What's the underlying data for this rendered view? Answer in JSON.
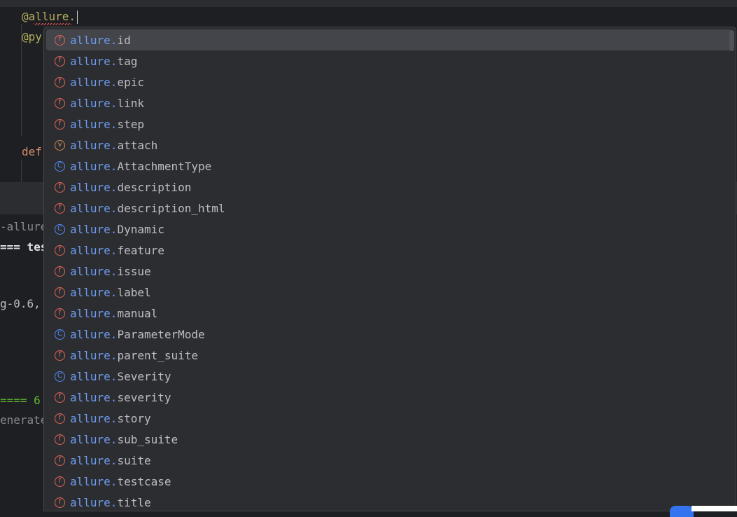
{
  "editor": {
    "line1": "@allure.",
    "line2": "@py",
    "line3": "def"
  },
  "console": {
    "l1": "-allure",
    "l2": "=== tes",
    "l3": "g-0.6,",
    "l4": "==== 6",
    "l5": "enerate"
  },
  "completion": {
    "prefix": "allure.",
    "items": [
      {
        "kind": "f",
        "name": "id"
      },
      {
        "kind": "f",
        "name": "tag"
      },
      {
        "kind": "f",
        "name": "epic"
      },
      {
        "kind": "f",
        "name": "link"
      },
      {
        "kind": "f",
        "name": "step"
      },
      {
        "kind": "v",
        "name": "attach"
      },
      {
        "kind": "c",
        "name": "AttachmentType"
      },
      {
        "kind": "f",
        "name": "description"
      },
      {
        "kind": "f",
        "name": "description_html"
      },
      {
        "kind": "c",
        "name": "Dynamic"
      },
      {
        "kind": "f",
        "name": "feature"
      },
      {
        "kind": "f",
        "name": "issue"
      },
      {
        "kind": "f",
        "name": "label"
      },
      {
        "kind": "f",
        "name": "manual"
      },
      {
        "kind": "c",
        "name": "ParameterMode"
      },
      {
        "kind": "f",
        "name": "parent_suite"
      },
      {
        "kind": "c",
        "name": "Severity"
      },
      {
        "kind": "f",
        "name": "severity"
      },
      {
        "kind": "f",
        "name": "story"
      },
      {
        "kind": "f",
        "name": "sub_suite"
      },
      {
        "kind": "f",
        "name": "suite"
      },
      {
        "kind": "f",
        "name": "testcase"
      },
      {
        "kind": "f",
        "name": "title"
      }
    ]
  },
  "icons": {
    "f": "function-icon",
    "v": "variable-icon",
    "c": "class-icon"
  },
  "colors": {
    "function": "#e0645c",
    "variable": "#d08a53",
    "class": "#548af7",
    "prefix": "#6f9bf0",
    "selection": "#43454a"
  }
}
